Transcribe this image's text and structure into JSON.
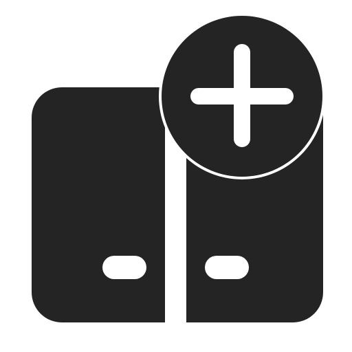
{
  "icon": {
    "name": "closet-add-icon",
    "color": "#242424",
    "background": "#ffffff"
  }
}
